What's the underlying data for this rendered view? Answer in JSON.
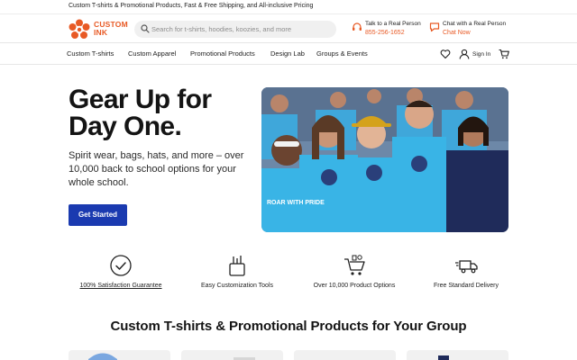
{
  "promo": {
    "text": "Custom T-shirts & Promotional Products, Fast & Free Shipping, and All-inclusive Pricing"
  },
  "header": {
    "logo_line1": "CUSTOM",
    "logo_line2": "INK",
    "search_placeholder": "Search for t-shirts, hoodies, koozies, and more",
    "phone": {
      "label": "Talk to a Real Person",
      "value": "855-256-1652",
      "icon": "headset-icon"
    },
    "chat": {
      "label": "Chat with a Real Person",
      "value": "Chat Now",
      "icon": "chat-bubble-icon"
    }
  },
  "nav": {
    "items": [
      "Custom T-shirts",
      "Custom Apparel",
      "Promotional Products",
      "Design Lab",
      "Groups & Events"
    ],
    "signin": "Sign In",
    "icons": [
      "heart-icon",
      "user-icon",
      "cart-icon"
    ]
  },
  "hero": {
    "title_line1": "Gear Up for",
    "title_line2": "Day One.",
    "subtitle": "Spirit wear, bags, hats, and more – over 10,000 back to school options for your whole school.",
    "cta": "Get Started",
    "shirt_text": "ROAR WITH PRIDE"
  },
  "features": [
    {
      "label": "100% Satisfaction Guarantee",
      "icon": "checkmark-badge-icon"
    },
    {
      "label": "Easy Customization Tools",
      "icon": "paint-tools-icon"
    },
    {
      "label": "Over 10,000 Product Options",
      "icon": "shopping-cart-products-icon"
    },
    {
      "label": "Free Standard Delivery",
      "icon": "delivery-truck-icon"
    }
  ],
  "section": {
    "title": "Custom T-shirts & Promotional Products for Your Group"
  },
  "colors": {
    "accent": "#e85a25",
    "cta": "#1a3ab0",
    "shirt": "#39b4e6"
  }
}
